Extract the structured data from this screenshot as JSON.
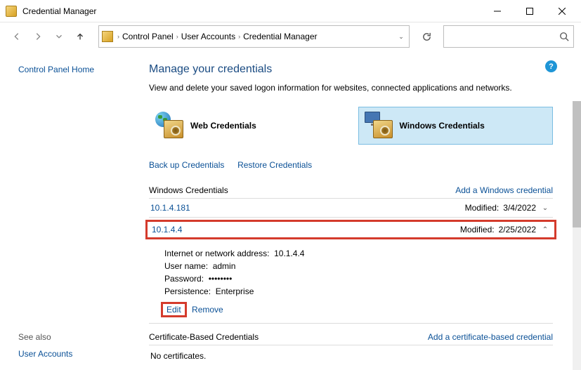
{
  "window": {
    "title": "Credential Manager"
  },
  "breadcrumb": {
    "root": "Control Panel",
    "mid": "User Accounts",
    "leaf": "Credential Manager"
  },
  "left": {
    "home": "Control Panel Home",
    "seealso": "See also",
    "useraccounts": "User Accounts"
  },
  "main": {
    "heading": "Manage your credentials",
    "sub": "View and delete your saved logon information for websites, connected applications and networks.",
    "tile_web": "Web Credentials",
    "tile_win": "Windows Credentials",
    "backup": "Back up Credentials",
    "restore": "Restore Credentials"
  },
  "wincred": {
    "title": "Windows Credentials",
    "add": "Add a Windows credential",
    "rows": [
      {
        "addr": "10.1.4.181",
        "mod_label": "Modified:",
        "mod_date": "3/4/2022"
      },
      {
        "addr": "10.1.4.4",
        "mod_label": "Modified:",
        "mod_date": "2/25/2022"
      }
    ]
  },
  "details": {
    "addr_label": "Internet or network address:",
    "addr_value": "10.1.4.4",
    "user_label": "User name:",
    "user_value": "admin",
    "pass_label": "Password:",
    "pass_value": "••••••••",
    "persist_label": "Persistence:",
    "persist_value": "Enterprise",
    "edit": "Edit",
    "remove": "Remove"
  },
  "certcred": {
    "title": "Certificate-Based Credentials",
    "add": "Add a certificate-based credential",
    "empty": "No certificates."
  }
}
